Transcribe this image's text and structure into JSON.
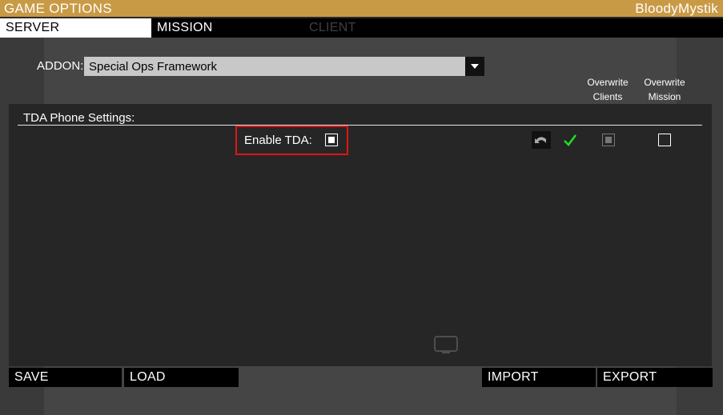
{
  "window": {
    "title": "GAME OPTIONS",
    "user": "BloodyMystik"
  },
  "tabs": [
    {
      "label": "SERVER",
      "state": "active"
    },
    {
      "label": "MISSION",
      "state": "normal"
    },
    {
      "label": "CLIENT",
      "state": "disabled"
    }
  ],
  "addon": {
    "label": "ADDON:",
    "selected": "Special Ops Framework"
  },
  "columns": {
    "overwrite_clients": "Overwrite Clients",
    "overwrite_mission": "Overwrite Mission"
  },
  "section": {
    "title": "TDA Phone Settings:"
  },
  "setting": {
    "label": "Enable TDA:",
    "enabled": true,
    "overwrite_clients": true,
    "overwrite_mission": false
  },
  "buttons": {
    "save": "SAVE",
    "load": "LOAD",
    "import": "IMPORT",
    "export": "EXPORT"
  },
  "colors": {
    "title_bar": "#c99a45",
    "highlight": "#e01515",
    "check": "#22dd22"
  },
  "icons": [
    "undo-icon",
    "checkmark-icon",
    "chevron-down-icon",
    "monitor-icon"
  ]
}
